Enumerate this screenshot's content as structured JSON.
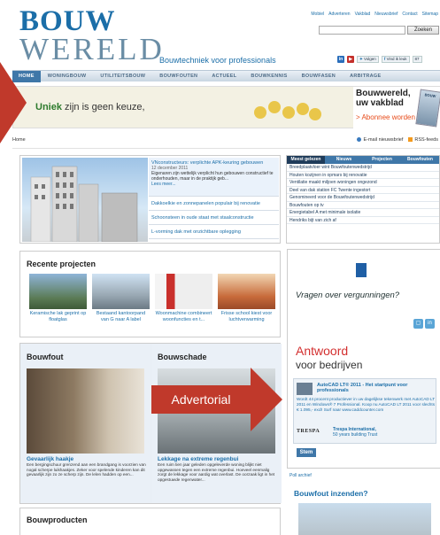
{
  "header": {
    "logo_line1": "BOUW",
    "logo_line2": "WERELD",
    "tagline": "Bouwtechniek voor professionals",
    "top_links": [
      "Mobiel",
      "Adverteren",
      "Vakblad",
      "Nieuwsbrief",
      "Contact",
      "Sitemap"
    ],
    "search_placeholder": "",
    "search_button": "Zoeken",
    "social": {
      "follow_label": "Volgen",
      "like_label": "Vind ik leuk",
      "like_count": "87"
    }
  },
  "nav": {
    "items": [
      "HOME",
      "WONINGBOUW",
      "UTILITEITSBOUW",
      "BOUWFOUTEN",
      "ACTUEEL",
      "BOUWKENNIS",
      "BOUWFASEN",
      "ARBITRAGE"
    ]
  },
  "banner": {
    "headline_strong": "Uniek",
    "headline_rest": " zijn is geen keuze,",
    "promo_title": "Bouwwereld, uw vakblad",
    "promo_cta": "> Abonnee worden",
    "promo_mag": "BOUW"
  },
  "breadcrumb": {
    "home": "Home",
    "email": "E-mail nieuwsbrief",
    "rss": "RSS-feeds"
  },
  "featured": {
    "first": {
      "title": "VNconstructeurs: verplichte APK-keuring gebouwen",
      "date": "12 december 2011",
      "body": "Eigenaren zijn wettelijk verplicht hun gebouwen constructief te onderhouden, maar in de praktijk geb...",
      "more": "Lees meer..."
    },
    "items": [
      "Dakkoelkie en zonnepanelen populair bij renovatie",
      "Schoonsteen in oude staat met staalconstructie",
      "L-vorming dak met onzichtbare oplegging"
    ]
  },
  "tabs": {
    "labels": [
      "Meest gelezen",
      "Nieuws",
      "Projecten",
      "Bouwfouten"
    ],
    "rows": [
      "Breedplaatvloer wint Bouwfoutenwedstrijd",
      "Houten kozijnen in opmars bij renovatie",
      "Ventilatie maakt miljoen woningen ongezond",
      "Deel van dak station FC Twente ingestort",
      "Genomineerd voor de Bouwfoutenwedstrijd",
      "Bouwfouten op tv",
      "Energietabel A met minimale isolatie",
      "Hendriks bijt van zich af"
    ]
  },
  "recent": {
    "title": "Recente projecten",
    "projects": [
      "Keramische lak geprint op floatglas",
      "Bestaand kantoorpand van G naar A label",
      "Woonmachine combineert woonfuncties en t...",
      "Frisse school kiest voor luchtverwarming"
    ]
  },
  "bouwfout": {
    "title": "Bouwfout",
    "headline": "Gevaarlijk haakje",
    "body": "Een bergingschuur grenzend aan een brandgang is voorzien van nogal scherpe luikhaakjes. Zeker voor spelende kinderen kan dit gevaarlijk zijn zo ze scherp zijn. De lelen hadden op een..."
  },
  "bouwschade": {
    "title": "Bouwschade",
    "headline": "Lekkage na extreme regenbui",
    "body": "Een ruim tien jaar geleden opgeleverde woning blijkt niet opgewassen tegen een extreme regenbui. Hoeveel eenmalig zorgt de lekkage voor aardig wat overlast. De oorzaak ligt in het opgestuwde regenwater..."
  },
  "callout": {
    "label": "Advertorial"
  },
  "bouwproducten": {
    "title": "Bouwproducten"
  },
  "ad": {
    "question": "Vragen over vergunningen?",
    "answer": "Antwoord",
    "answer_sub": "voor bedrijven",
    "box_title": "AutoCAD LT® 2011 - Het startpunt voor professionals",
    "box_body": "Wordt 44 procent productiever in uw dagelijkse tekenwerk met AutoCAD LT 2011 en Windows® 7 Professional. Koop nu AutoCAD LT 2011 voor slechts € 1.095,- excl! Surf naar www.caddcounter.com",
    "trespa_logo": "TRESPA",
    "trespa_title": "Trespa International,",
    "trespa_sub": "50 years building Trust",
    "button": "Stem",
    "archive": "Poll archief",
    "submit_title": "Bouwfout inzenden?"
  },
  "colors": {
    "brand_blue": "#1b6ea8",
    "nav_active": "#3f77a8",
    "callout_red": "#c0392b",
    "promo_orange": "#e74c1b"
  }
}
